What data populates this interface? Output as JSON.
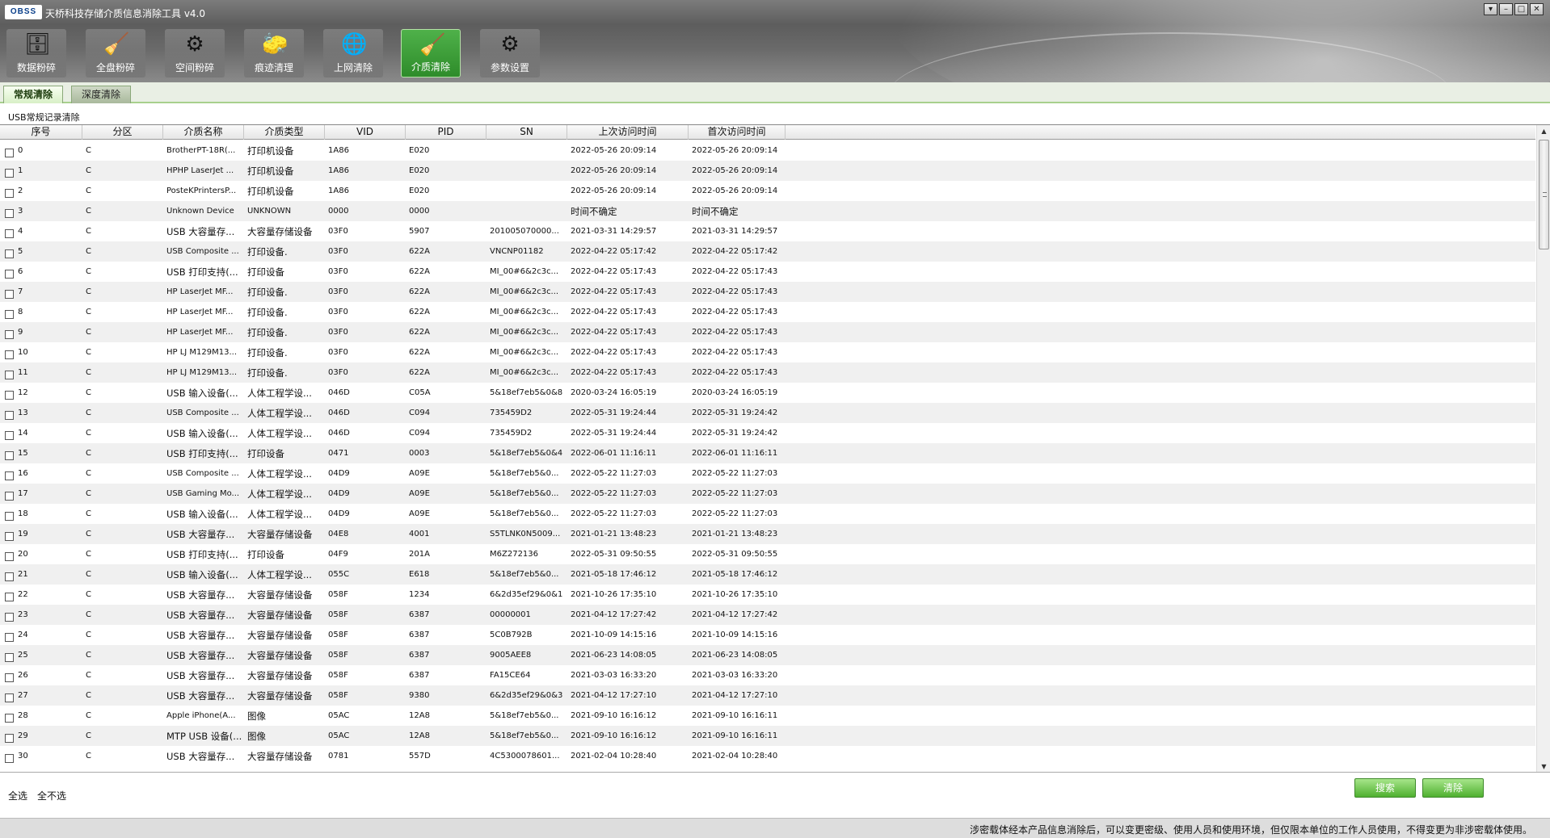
{
  "app": {
    "logo_text": "OBSS",
    "title": "天桥科技存储介质信息消除工具 v4.0",
    "win_buttons": [
      "▾",
      "–",
      "□",
      "✕"
    ]
  },
  "toolbar": [
    {
      "label": "数据粉碎",
      "icon": "shredder-icon",
      "glyph": "🗄"
    },
    {
      "label": "全盘粉碎",
      "icon": "disk-shred-icon",
      "glyph": "🧹"
    },
    {
      "label": "空间粉碎",
      "icon": "space-gear-icon",
      "glyph": "⚙"
    },
    {
      "label": "痕迹清理",
      "icon": "eraser-icon",
      "glyph": "🧽"
    },
    {
      "label": "上网清除",
      "icon": "globe-icon",
      "glyph": "🌐"
    },
    {
      "label": "介质清除",
      "icon": "broom-icon",
      "glyph": "🧹",
      "active": true
    },
    {
      "label": "参数设置",
      "icon": "settings-gear-icon",
      "glyph": "⚙"
    }
  ],
  "tabs": [
    {
      "label": "常规清除",
      "selected": true
    },
    {
      "label": "深度清除",
      "selected": false
    }
  ],
  "section_label": "USB常规记录清除",
  "columns": [
    "序号",
    "分区",
    "介质名称",
    "介质类型",
    "VID",
    "PID",
    "SN",
    "上次访问时间",
    "首次访问时间"
  ],
  "rows": [
    [
      "0",
      "C",
      "BrotherPT-18R(...",
      "打印机设备",
      "1A86",
      "E020",
      "",
      "2022-05-26 20:09:14",
      "2022-05-26 20:09:14"
    ],
    [
      "1",
      "C",
      "HPHP LaserJet ...",
      "打印机设备",
      "1A86",
      "E020",
      "",
      "2022-05-26 20:09:14",
      "2022-05-26 20:09:14"
    ],
    [
      "2",
      "C",
      "PosteKPrintersP...",
      "打印机设备",
      "1A86",
      "E020",
      "",
      "2022-05-26 20:09:14",
      "2022-05-26 20:09:14"
    ],
    [
      "3",
      "C",
      "Unknown Device",
      "UNKNOWN",
      "0000",
      "0000",
      "",
      "时间不确定",
      "时间不确定"
    ],
    [
      "4",
      "C",
      "USB 大容量存...",
      "大容量存储设备",
      "03F0",
      "5907",
      "201005070000...",
      "2021-03-31 14:29:57",
      "2021-03-31 14:29:57"
    ],
    [
      "5",
      "C",
      "USB Composite ...",
      "打印设备.",
      "03F0",
      "622A",
      "VNCNP01182",
      "2022-04-22 05:17:42",
      "2022-04-22 05:17:42"
    ],
    [
      "6",
      "C",
      "USB 打印支持(...",
      "打印设备",
      "03F0",
      "622A",
      "MI_00#6&2c3c...",
      "2022-04-22 05:17:43",
      "2022-04-22 05:17:43"
    ],
    [
      "7",
      "C",
      "HP LaserJet MF...",
      "打印设备.",
      "03F0",
      "622A",
      "MI_00#6&2c3c...",
      "2022-04-22 05:17:43",
      "2022-04-22 05:17:43"
    ],
    [
      "8",
      "C",
      "HP LaserJet MF...",
      "打印设备.",
      "03F0",
      "622A",
      "MI_00#6&2c3c...",
      "2022-04-22 05:17:43",
      "2022-04-22 05:17:43"
    ],
    [
      "9",
      "C",
      "HP LaserJet MF...",
      "打印设备.",
      "03F0",
      "622A",
      "MI_00#6&2c3c...",
      "2022-04-22 05:17:43",
      "2022-04-22 05:17:43"
    ],
    [
      "10",
      "C",
      "HP LJ M129M13...",
      "打印设备.",
      "03F0",
      "622A",
      "MI_00#6&2c3c...",
      "2022-04-22 05:17:43",
      "2022-04-22 05:17:43"
    ],
    [
      "11",
      "C",
      "HP LJ M129M13...",
      "打印设备.",
      "03F0",
      "622A",
      "MI_00#6&2c3c...",
      "2022-04-22 05:17:43",
      "2022-04-22 05:17:43"
    ],
    [
      "12",
      "C",
      "USB 输入设备(...",
      "人体工程学设...",
      "046D",
      "C05A",
      "5&18ef7eb5&0&8",
      "2020-03-24 16:05:19",
      "2020-03-24 16:05:19"
    ],
    [
      "13",
      "C",
      "USB Composite ...",
      "人体工程学设...",
      "046D",
      "C094",
      "735459D2",
      "2022-05-31 19:24:44",
      "2022-05-31 19:24:42"
    ],
    [
      "14",
      "C",
      "USB 输入设备(...",
      "人体工程学设...",
      "046D",
      "C094",
      "735459D2",
      "2022-05-31 19:24:44",
      "2022-05-31 19:24:42"
    ],
    [
      "15",
      "C",
      "USB 打印支持(...",
      "打印设备",
      "0471",
      "0003",
      "5&18ef7eb5&0&4",
      "2022-06-01 11:16:11",
      "2022-06-01 11:16:11"
    ],
    [
      "16",
      "C",
      "USB Composite ...",
      "人体工程学设...",
      "04D9",
      "A09E",
      "5&18ef7eb5&0...",
      "2022-05-22 11:27:03",
      "2022-05-22 11:27:03"
    ],
    [
      "17",
      "C",
      "USB Gaming Mo...",
      "人体工程学设...",
      "04D9",
      "A09E",
      "5&18ef7eb5&0...",
      "2022-05-22 11:27:03",
      "2022-05-22 11:27:03"
    ],
    [
      "18",
      "C",
      "USB 输入设备(...",
      "人体工程学设...",
      "04D9",
      "A09E",
      "5&18ef7eb5&0...",
      "2022-05-22 11:27:03",
      "2022-05-22 11:27:03"
    ],
    [
      "19",
      "C",
      "USB 大容量存...",
      "大容量存储设备",
      "04E8",
      "4001",
      "S5TLNK0N5009...",
      "2021-01-21 13:48:23",
      "2021-01-21 13:48:23"
    ],
    [
      "20",
      "C",
      "USB 打印支持(...",
      "打印设备",
      "04F9",
      "201A",
      "M6Z272136",
      "2022-05-31 09:50:55",
      "2022-05-31 09:50:55"
    ],
    [
      "21",
      "C",
      "USB 输入设备(...",
      "人体工程学设...",
      "055C",
      "E618",
      "5&18ef7eb5&0...",
      "2021-05-18 17:46:12",
      "2021-05-18 17:46:12"
    ],
    [
      "22",
      "C",
      "USB 大容量存...",
      "大容量存储设备",
      "058F",
      "1234",
      "6&2d35ef29&0&1",
      "2021-10-26 17:35:10",
      "2021-10-26 17:35:10"
    ],
    [
      "23",
      "C",
      "USB 大容量存...",
      "大容量存储设备",
      "058F",
      "6387",
      "00000001",
      "2021-04-12 17:27:42",
      "2021-04-12 17:27:42"
    ],
    [
      "24",
      "C",
      "USB 大容量存...",
      "大容量存储设备",
      "058F",
      "6387",
      "5C0B792B",
      "2021-10-09 14:15:16",
      "2021-10-09 14:15:16"
    ],
    [
      "25",
      "C",
      "USB 大容量存...",
      "大容量存储设备",
      "058F",
      "6387",
      "9005AEE8",
      "2021-06-23 14:08:05",
      "2021-06-23 14:08:05"
    ],
    [
      "26",
      "C",
      "USB 大容量存...",
      "大容量存储设备",
      "058F",
      "6387",
      "FA15CE64",
      "2021-03-03 16:33:20",
      "2021-03-03 16:33:20"
    ],
    [
      "27",
      "C",
      "USB 大容量存...",
      "大容量存储设备",
      "058F",
      "9380",
      "6&2d35ef29&0&3",
      "2021-04-12 17:27:10",
      "2021-04-12 17:27:10"
    ],
    [
      "28",
      "C",
      "Apple iPhone(A...",
      "图像",
      "05AC",
      "12A8",
      "5&18ef7eb5&0...",
      "2021-09-10 16:16:12",
      "2021-09-10 16:16:11"
    ],
    [
      "29",
      "C",
      "MTP USB 设备(...",
      "图像",
      "05AC",
      "12A8",
      "5&18ef7eb5&0...",
      "2021-09-10 16:16:12",
      "2021-09-10 16:16:11"
    ],
    [
      "30",
      "C",
      "USB 大容量存...",
      "大容量存储设备",
      "0781",
      "557D",
      "4C5300078601...",
      "2021-02-04 10:28:40",
      "2021-02-04 10:28:40"
    ]
  ],
  "footer": {
    "select_all": "全选",
    "select_none": "全不选",
    "search_label": "搜索",
    "clear_label": "清除"
  },
  "status_text": "涉密载体经本产品信息消除后，可以变更密级、使用人员和使用环境，但仅限本单位的工作人员使用，不得变更为非涉密载体使用。",
  "colors": {
    "accent_green": "#4fb030",
    "toolbar_gray": "#6a6a6a"
  }
}
